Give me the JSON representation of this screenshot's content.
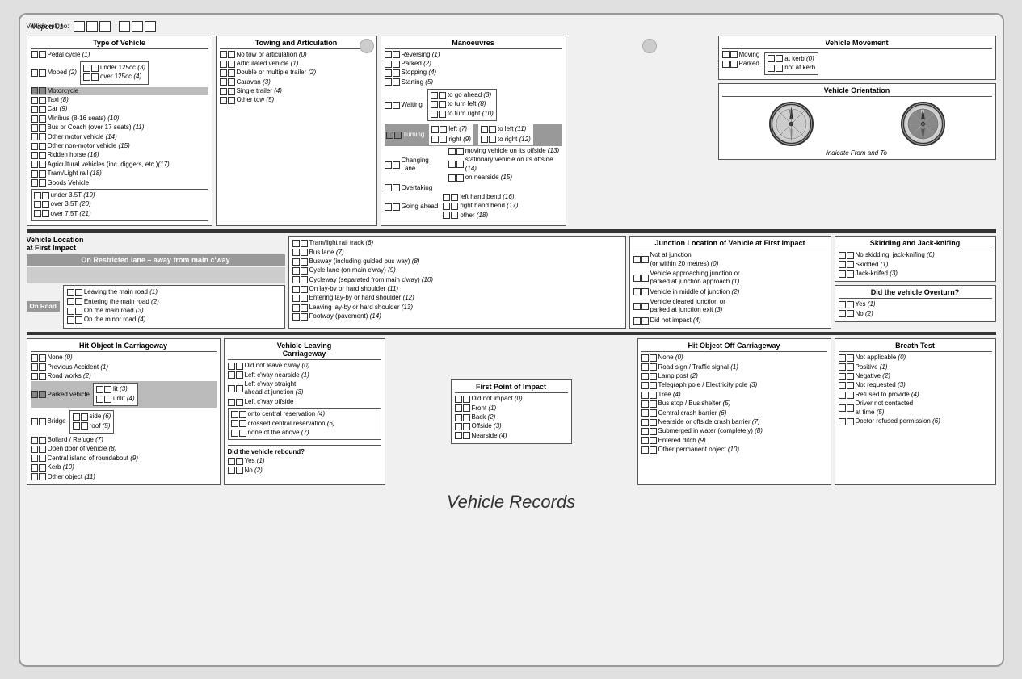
{
  "page": {
    "title": "Vehicle Records",
    "ref_label": "Vehicle ref. no:",
    "moped_label": "Moped 01"
  },
  "type_of_vehicle": {
    "title": "Type of Vehicle",
    "items": [
      "Pedal cycle (1)",
      "Moped (2)",
      "Motorcycle",
      "Taxi (8)",
      "Car (9)",
      "Minibus (8-16 seats) (10)",
      "Bus or Coach (over 17 seats) (11)",
      "Other motor vehicle (14)",
      "Other non-motor vehicle (15)",
      "Ridden horse (16)",
      "Agricultural vehicles (inc. diggers, etc.)(17)",
      "Tram/Light rail (18)",
      "Goods Vehicle"
    ],
    "sub_items": [
      "under 125cc (3)",
      "over 125cc (4)"
    ],
    "goods_items": [
      "under 3.5T (19)",
      "over 3.5T (20)",
      "over 7.5T (21)"
    ]
  },
  "towing": {
    "title": "Towing and Articulation",
    "items": [
      "No tow or articulation (0)",
      "Articulated vehicle (1)",
      "Double or multiple trailer (2)",
      "Caravan (3)",
      "Single trailer (4)",
      "Other tow (5)"
    ]
  },
  "manoeuvres": {
    "title": "Manoeuvres",
    "items": [
      "Reversing (1)",
      "Parked (2)",
      "Stopping (4)",
      "Starting (5)",
      "Waiting",
      "Turning",
      "Changing Lane",
      "Overtaking",
      "Going ahead"
    ],
    "sub_go_ahead": [
      "to go ahead (3)",
      "to turn left (8)",
      "to turn right (10)"
    ],
    "sub_left_right": [
      "left (7)",
      "right (9)"
    ],
    "sub_to": [
      "to left (11)",
      "to right (12)"
    ],
    "sub_going": [
      "left hand bend (16)",
      "right hand bend (17)",
      "other (18)"
    ],
    "sub_moving": [
      "moving vehicle on its offside (13)",
      "stationary vehicle on its offside (14)",
      "on nearside (15)"
    ]
  },
  "vehicle_movement": {
    "title": "Vehicle Movement",
    "items": [
      "Moving",
      "Parked"
    ],
    "sub": [
      "at kerb (0)",
      "not at kerb"
    ]
  },
  "vehicle_orientation": {
    "title": "Vehicle Orientation",
    "label": "indicate From and To"
  },
  "vehicle_location": {
    "title": "Vehicle Location\nat First Impact",
    "restricted_label": "On Restricted lane – away from main c'way",
    "on_road_label": "On Road",
    "on_road_items": [
      "Leaving the main road (1)",
      "Entering the main road (2)",
      "On the main road (3)",
      "On the minor road (4)"
    ],
    "lane_items": [
      "Tram/light rail track (6)",
      "Bus lane (7)",
      "Busway (including guided bus way) (8)",
      "Cycle lane (on main c'way) (9)",
      "Cycleway (separated from main c'way) (10)",
      "On lay-by or hard shoulder (11)",
      "Entering lay-by or hard shoulder (12)",
      "Leaving lay-by or hard shoulder (13)",
      "Footway (pavement) (14)"
    ]
  },
  "junction_location": {
    "title": "Junction Location of Vehicle\nat First Impact",
    "items": [
      "Not at junction\n(or within 20 metres) (0)",
      "Vehicle approaching junction or\nparked at junction approach (1)",
      "Vehicle in middle of junction (2)",
      "Vehicle cleared junction or\nparked at junction exit (3)",
      "Did not impact (4)"
    ]
  },
  "skidding": {
    "title": "Skidding and Jack-knifing",
    "items": [
      "No skidding, jack-knifing (0)",
      "Skidded (1)",
      "Jack-knifed (3)"
    ]
  },
  "overturn": {
    "title": "Did the vehicle Overturn?",
    "items": [
      "Yes (1)",
      "No (2)"
    ]
  },
  "hit_object_in": {
    "title": "Hit Object In Carriageway",
    "items": [
      "None (0)",
      "Previous Accident (1)",
      "Road works (2)",
      "Parked vehicle",
      "Bridge",
      "Bollard / Refuge (7)",
      "Open door of vehicle (8)",
      "Central island of roundabout (9)",
      "Kerb (10)",
      "Other object (11)"
    ],
    "sub_parked": [
      "lit (3)",
      "unlit (4)"
    ],
    "sub_bridge": [
      "side (6)",
      "roof (5)"
    ]
  },
  "vehicle_leaving": {
    "title": "Vehicle Leaving\nCarriageway",
    "items": [
      "Did not leave c'way (0)",
      "Left c'way nearside (1)",
      "Left c'way straight\nahead at junction (3)",
      "Left c'way offside"
    ],
    "sub_offside": [
      "onto central reservation (4)",
      "crossed central reservation (6)",
      "none of the above (7)"
    ],
    "rebound_title": "Did the vehicle rebound?",
    "rebound_items": [
      "Yes (1)",
      "No (2)"
    ]
  },
  "first_point_impact": {
    "title": "First Point of Impact",
    "items": [
      "Did not impact (0)",
      "Front (1)",
      "Back (2)",
      "Offside (3)",
      "Nearside (4)"
    ]
  },
  "hit_object_off": {
    "title": "Hit Object Off Carriageway",
    "items": [
      "None (0)",
      "Road sign / Traffic signal (1)",
      "Lamp post (2)",
      "Telegraph pole / Electricity pole (3)",
      "Tree (4)",
      "Bus stop / Bus shelter (5)",
      "Central crash barrier (6)",
      "Nearside or offside crash barrier (7)",
      "Submerged in water (completely) (8)",
      "Entered ditch (9)",
      "Other permanent object (10)"
    ]
  },
  "breath_test": {
    "title": "Breath Test",
    "items": [
      "Not applicable (0)",
      "Positive (1)",
      "Negative (2)",
      "Not requested (3)",
      "Refused to provide (4)",
      "Driver not contacted\nat time (5)",
      "Doctor refused permission (6)"
    ]
  }
}
